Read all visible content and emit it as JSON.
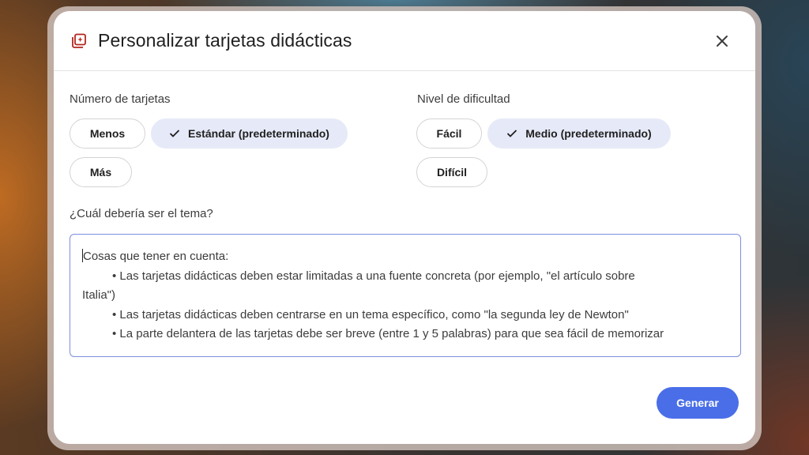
{
  "dialog": {
    "title": "Personalizar tarjetas didácticas",
    "title_icon": "flashcards-icon",
    "close_icon": "close-icon"
  },
  "cards_count": {
    "label": "Número de tarjetas",
    "options": [
      "Menos",
      "Estándar (predeterminado)",
      "Más"
    ],
    "selected": "Estándar (predeterminado)"
  },
  "difficulty": {
    "label": "Nivel de dificultad",
    "options": [
      "Fácil",
      "Medio (predeterminado)",
      "Difícil"
    ],
    "selected": "Medio (predeterminado)"
  },
  "topic": {
    "label": "¿Cuál debería ser el tema?",
    "intro": "Cosas que tener en cuenta:",
    "bullets": [
      {
        "first": "• Las tarjetas didácticas deben estar limitadas a una fuente concreta (por ejemplo, \"el artículo sobre",
        "rest": "Italia\")"
      },
      {
        "first": "• Las tarjetas didácticas deben centrarse en un tema específico, como \"la segunda ley de Newton\"",
        "rest": ""
      },
      {
        "first": "• La parte delantera de las tarjetas debe ser breve (entre 1 y 5 palabras) para que sea fácil de memorizar",
        "rest": ""
      }
    ]
  },
  "actions": {
    "generate_label": "Generar"
  },
  "colors": {
    "primary": "#4a6ee8",
    "selected_chip": "#e6eaf8",
    "icon_accent": "#b3261e"
  }
}
